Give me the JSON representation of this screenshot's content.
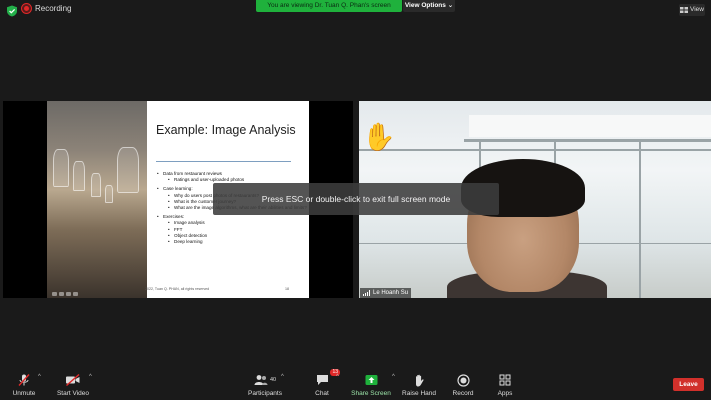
{
  "top": {
    "recording_label": "Recording",
    "share_banner": "You are viewing Dr. Tuan Q. Phan's screen",
    "view_options_label": "View Options",
    "view_label": "View"
  },
  "slide": {
    "title": "Example: Image Analysis",
    "bullets": [
      {
        "level": 1,
        "text": "Data from restaurant reviews"
      },
      {
        "level": 2,
        "text": "Ratings and user-uploaded photos"
      },
      {
        "level": 1,
        "text": "Case learning:"
      },
      {
        "level": 2,
        "text": "Why do users post photos of restaurants?"
      },
      {
        "level": 2,
        "text": "What is the customer journey?"
      },
      {
        "level": 2,
        "text": "What are the image algorithms, what are their abilities and limits?"
      },
      {
        "level": 1,
        "text": "Exercises:"
      },
      {
        "level": 2,
        "text": "Image analysis"
      },
      {
        "level": 2,
        "text": "FFT"
      },
      {
        "level": 2,
        "text": "Object detection"
      },
      {
        "level": 2,
        "text": "Deep learning"
      }
    ],
    "footer": "2022, Tuan Q. PHAN, all rights reserved",
    "page_number": "18"
  },
  "video": {
    "participant_name": "Le Hoanh Su"
  },
  "toast": {
    "message": "Press ESC or double-click to exit full screen mode"
  },
  "toolbar": {
    "unmute_label": "Unmute",
    "start_video_label": "Start Video",
    "participants_label": "Participants",
    "participants_count": "40",
    "chat_label": "Chat",
    "chat_badge": "13",
    "share_screen_label": "Share Screen",
    "raise_hand_label": "Raise Hand",
    "record_label": "Record",
    "apps_label": "Apps",
    "leave_label": "Leave"
  },
  "colors": {
    "share_green": "#1fb13c",
    "leave_red": "#d1302b",
    "badge_red": "#e02828"
  }
}
